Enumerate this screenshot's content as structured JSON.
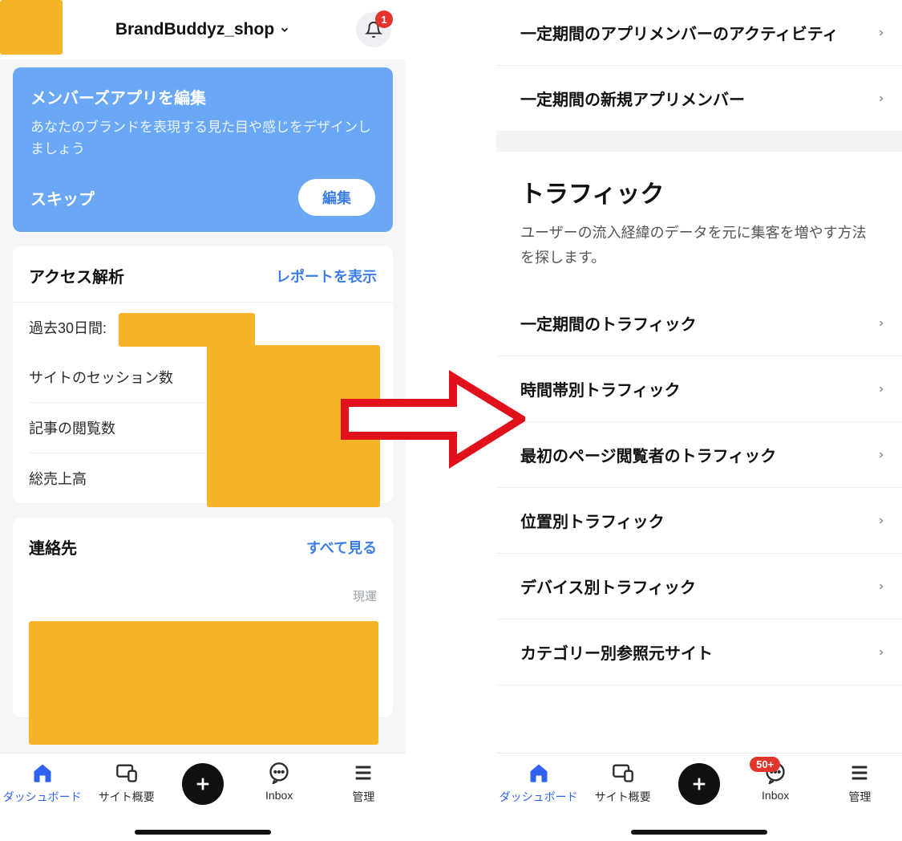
{
  "left": {
    "header": {
      "brand": "BrandBuddyz_shop",
      "bell_count": "1"
    },
    "promo": {
      "title": "メンバーズアプリを編集",
      "sub": "あなたのブランドを表現する見た目や感じをデザインしましょう",
      "skip": "スキップ",
      "edit": "編集"
    },
    "analytics": {
      "title": "アクセス解析",
      "link": "レポートを表示",
      "period_label": "過去30日間:",
      "rows": {
        "sessions": "サイトのセッション数",
        "article_views": "記事の閲覧数",
        "total_sales": "総売上高"
      }
    },
    "contacts": {
      "title": "連絡先",
      "link": "すべて見る",
      "hint": "現運"
    },
    "nav": {
      "dashboard": "ダッシュボード",
      "site": "サイト概要",
      "inbox": "Inbox",
      "manage": "管理"
    }
  },
  "right": {
    "top_rows": {
      "activity": "一定期間のアプリメンバーのアクティビティ",
      "new_members": "一定期間の新規アプリメンバー"
    },
    "traffic": {
      "title": "トラフィック",
      "sub": "ユーザーの流入経緯のデータを元に集客を増やす方法を探します。",
      "rows": {
        "period": "一定期間のトラフィック",
        "by_time": "時間帯別トラフィック",
        "first_page": "最初のページ閲覧者のトラフィック",
        "by_location": "位置別トラフィック",
        "by_device": "デバイス別トラフィック",
        "by_referrer": "カテゴリー別参照元サイト"
      }
    },
    "nav": {
      "dashboard": "ダッシュボード",
      "site": "サイト概要",
      "inbox": "Inbox",
      "inbox_badge": "50+",
      "manage": "管理"
    }
  }
}
